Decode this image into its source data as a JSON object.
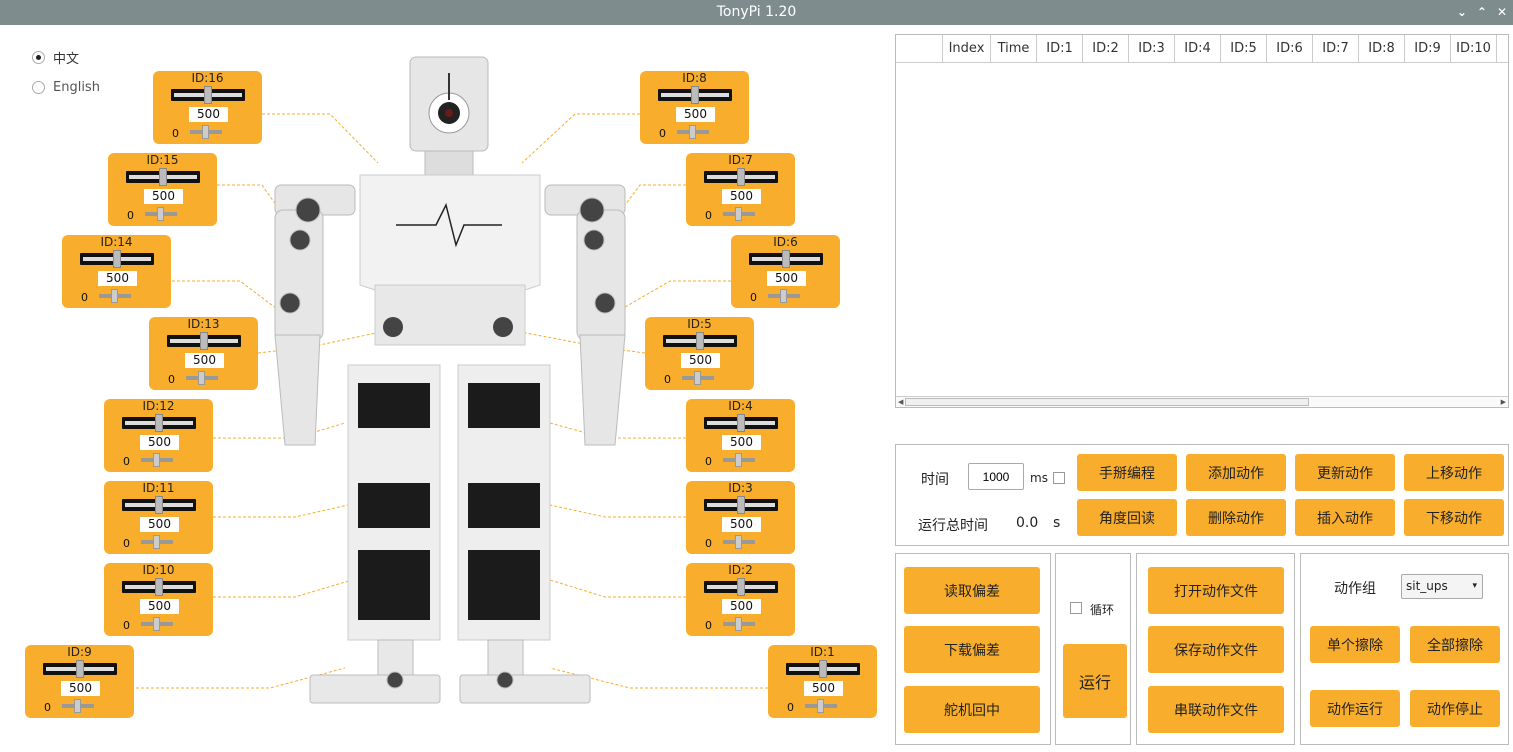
{
  "window": {
    "title": "TonyPi 1.20"
  },
  "language": {
    "options": [
      "中文",
      "English"
    ],
    "selected": "中文"
  },
  "servos": [
    {
      "label": "ID:16",
      "value": "500",
      "min": "0"
    },
    {
      "label": "ID:15",
      "value": "500",
      "min": "0"
    },
    {
      "label": "ID:14",
      "value": "500",
      "min": "0"
    },
    {
      "label": "ID:13",
      "value": "500",
      "min": "0"
    },
    {
      "label": "ID:12",
      "value": "500",
      "min": "0"
    },
    {
      "label": "ID:11",
      "value": "500",
      "min": "0"
    },
    {
      "label": "ID:10",
      "value": "500",
      "min": "0"
    },
    {
      "label": "ID:9",
      "value": "500",
      "min": "0"
    },
    {
      "label": "ID:8",
      "value": "500",
      "min": "0"
    },
    {
      "label": "ID:7",
      "value": "500",
      "min": "0"
    },
    {
      "label": "ID:6",
      "value": "500",
      "min": "0"
    },
    {
      "label": "ID:5",
      "value": "500",
      "min": "0"
    },
    {
      "label": "ID:4",
      "value": "500",
      "min": "0"
    },
    {
      "label": "ID:3",
      "value": "500",
      "min": "0"
    },
    {
      "label": "ID:2",
      "value": "500",
      "min": "0"
    },
    {
      "label": "ID:1",
      "value": "500",
      "min": "0"
    }
  ],
  "table": {
    "columns": [
      "",
      "Index",
      "Time",
      "ID:1",
      "ID:2",
      "ID:3",
      "ID:4",
      "ID:5",
      "ID:6",
      "ID:7",
      "ID:8",
      "ID:9",
      "ID:10"
    ]
  },
  "edit": {
    "time_label": "时间",
    "time_value": "1000",
    "time_unit": "ms",
    "total_label": "运行总时间",
    "total_value": "0.0",
    "total_unit": "s",
    "buttons": [
      "手掰编程",
      "添加动作",
      "更新动作",
      "上移动作",
      "角度回读",
      "删除动作",
      "插入动作",
      "下移动作"
    ]
  },
  "deviation": {
    "buttons": [
      "读取偏差",
      "下载偏差",
      "舵机回中"
    ]
  },
  "run": {
    "loop_label": "循环",
    "run_label": "运行"
  },
  "files": {
    "buttons": [
      "打开动作文件",
      "保存动作文件",
      "串联动作文件"
    ]
  },
  "group": {
    "label": "动作组",
    "selected": "sit_ups",
    "buttons": [
      "单个擦除",
      "全部擦除",
      "动作运行",
      "动作停止"
    ]
  },
  "colors": {
    "accent": "#f8ad2c",
    "titlebar": "#7f8c8d"
  }
}
